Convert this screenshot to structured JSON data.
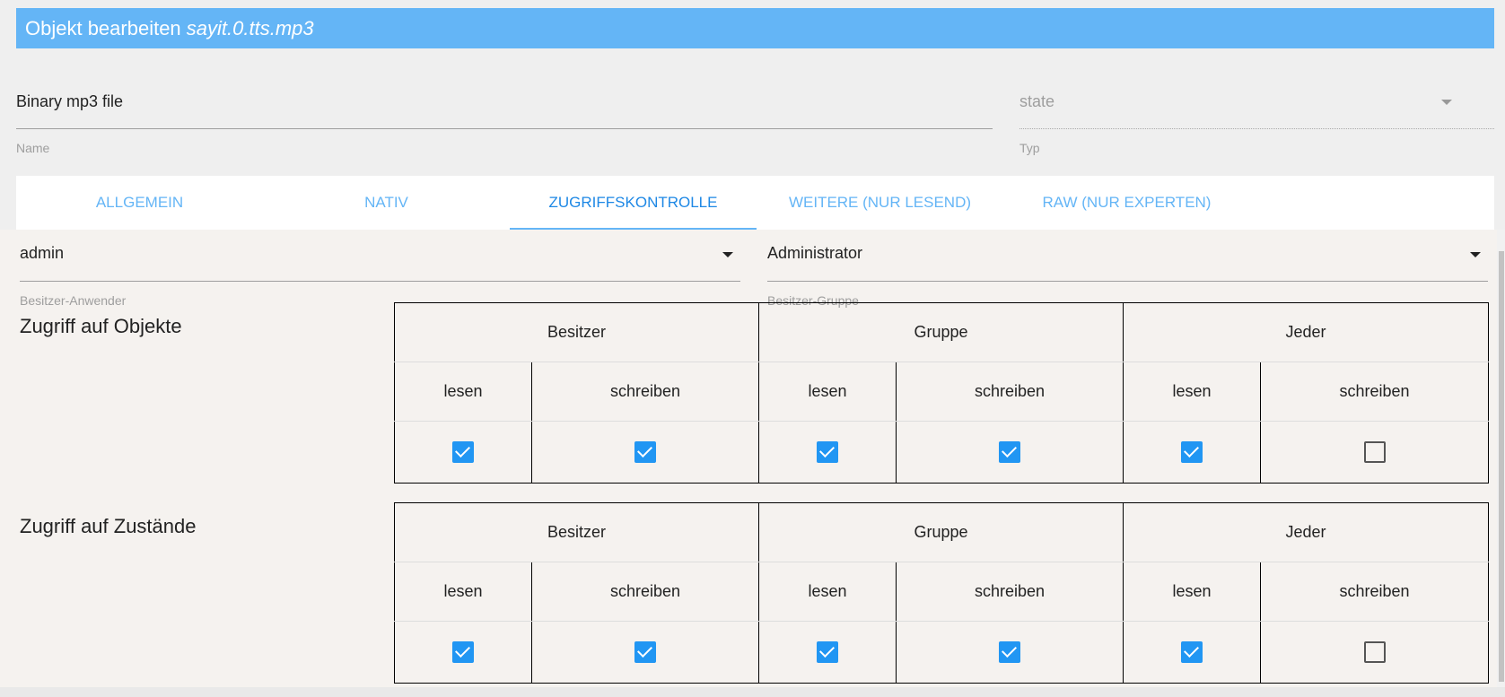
{
  "title": {
    "prefix": "Objekt bearbeiten",
    "object_id": "sayit.0.tts.mp3"
  },
  "name_field": {
    "value": "Binary mp3 file",
    "helper": "Name"
  },
  "type_field": {
    "value": "state",
    "helper": "Typ"
  },
  "tabs": [
    {
      "label": "ALLGEMEIN"
    },
    {
      "label": "NATIV"
    },
    {
      "label": "ZUGRIFFSKONTROLLE",
      "active": true
    },
    {
      "label": "WEITERE (NUR LESEND)"
    },
    {
      "label": "RAW (NUR EXPERTEN)"
    }
  ],
  "owner_user": {
    "value": "admin",
    "helper": "Besitzer-Anwender"
  },
  "owner_group": {
    "value": "Administrator",
    "helper": "Besitzer-Gruppe"
  },
  "headers": {
    "owner": "Besitzer",
    "group": "Gruppe",
    "everyone": "Jeder",
    "read": "lesen",
    "write": "schreiben"
  },
  "objects_access": {
    "label": "Zugriff auf Objekte",
    "checks": [
      true,
      true,
      true,
      true,
      true,
      false
    ]
  },
  "states_access": {
    "label": "Zugriff auf Zustände",
    "checks": [
      true,
      true,
      true,
      true,
      true,
      false
    ]
  }
}
